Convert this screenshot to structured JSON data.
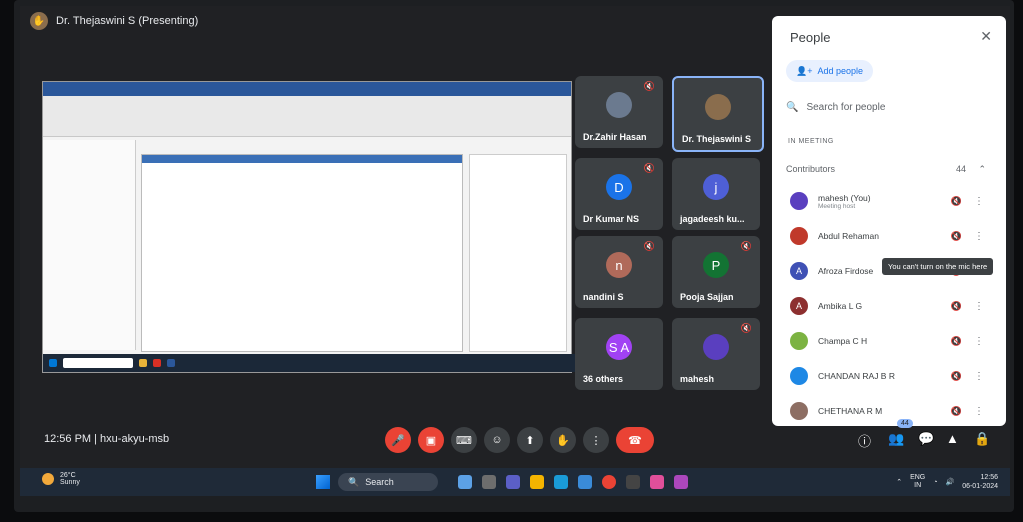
{
  "presenter": {
    "label": "Dr. Thejaswini S (Presenting)"
  },
  "tiles": [
    {
      "name": "Dr.Zahir Hasan",
      "avatar": "",
      "avatar_color": "#6b7a8f",
      "muted": true
    },
    {
      "name": "Dr. Thejaswini S",
      "avatar": "",
      "avatar_color": "#8a6d4d",
      "muted": false,
      "active": true
    },
    {
      "name": "Dr Kumar NS",
      "avatar": "D",
      "avatar_color": "#1a73e8",
      "muted": true
    },
    {
      "name": "jagadeesh ku...",
      "avatar": "j",
      "avatar_color": "#4e5fd6",
      "muted": false
    },
    {
      "name": "nandini S",
      "avatar": "n",
      "avatar_color": "#b06a5a",
      "muted": true
    },
    {
      "name": "Pooja Sajjan",
      "avatar": "P",
      "avatar_color": "#137333",
      "muted": true
    },
    {
      "name": "36 others",
      "avatar": "S A",
      "avatar_color": "#a142f4",
      "muted": false
    },
    {
      "name": "mahesh",
      "avatar": "",
      "avatar_color": "#5a3fbf",
      "muted": true
    }
  ],
  "panel": {
    "title": "People",
    "close": "✕",
    "add_people": "Add people",
    "search_placeholder": "Search for people",
    "in_meeting": "IN MEETING",
    "contributors_label": "Contributors",
    "contributors_count": "44",
    "people": [
      {
        "name": "mahesh (You)",
        "sub": "Meeting host",
        "avatar": "",
        "color": "#5a3fbf"
      },
      {
        "name": "Abdul Rehaman",
        "sub": "",
        "avatar": "",
        "color": "#c0392b"
      },
      {
        "name": "Afroza Firdose",
        "sub": "",
        "avatar": "A",
        "color": "#3f51b5"
      },
      {
        "name": "Ambika L G",
        "sub": "",
        "avatar": "A",
        "color": "#8d2f2f"
      },
      {
        "name": "Champa C H",
        "sub": "",
        "avatar": "",
        "color": "#7cb342"
      },
      {
        "name": "CHANDAN RAJ B R",
        "sub": "",
        "avatar": "",
        "color": "#1e88e5"
      },
      {
        "name": "CHETHANA R M",
        "sub": "",
        "avatar": "",
        "color": "#8d6e63"
      }
    ],
    "tooltip": "You can't turn on the mic here"
  },
  "bottom": {
    "meeting_info": "12:56 PM | hxu-akyu-msb",
    "people_badge": "44"
  },
  "taskbar": {
    "weather_temp": "26°C",
    "weather_desc": "Sunny",
    "search_label": "Search",
    "lang": "ENG",
    "region": "IN",
    "time": "12:56",
    "date": "06-01-2024"
  }
}
